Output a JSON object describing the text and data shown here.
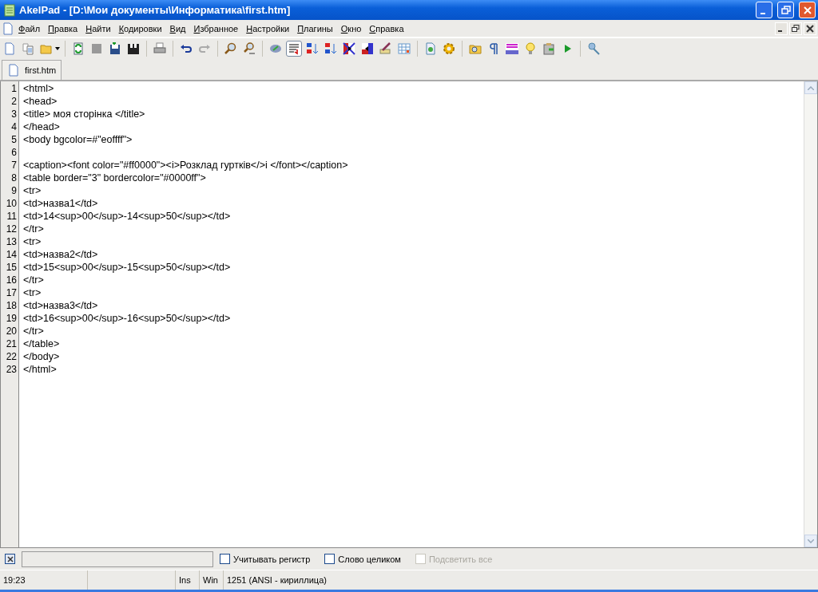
{
  "window": {
    "title": "AkelPad - [D:\\Мои документы\\Информатика\\first.htm]"
  },
  "menu": [
    "Файл",
    "Правка",
    "Найти",
    "Кодировки",
    "Вид",
    "Избранное",
    "Настройки",
    "Плагины",
    "Окно",
    "Справка"
  ],
  "tabs": [
    {
      "label": "first.htm",
      "selected": true
    }
  ],
  "editor": {
    "lines": [
      {
        "number": "1",
        "text": "<html>"
      },
      {
        "number": "2",
        "text": "<head>"
      },
      {
        "number": "3",
        "text": "<title> моя сторінка </title>"
      },
      {
        "number": "4",
        "text": "</head>"
      },
      {
        "number": "5",
        "text": "<body bgcolor=#\"eoffff\">"
      },
      {
        "number": "6"
      },
      {
        "number": "7",
        "text": "<caption><font color=\"#ff0000\"><i>Розклад гуртків</>i </font></caption>"
      },
      {
        "number": "8",
        "text": "<table border=\"3\" bordercolor=\"#0000ff\">"
      },
      {
        "number": "9",
        "text": "<tr>"
      },
      {
        "number": "10",
        "text": "<td>назва1</td>"
      },
      {
        "number": "11",
        "text": "<td>14<sup>00</sup>-14<sup>50</sup></td>"
      },
      {
        "number": "12",
        "text": "</tr>"
      },
      {
        "number": "13",
        "text": "<tr>"
      },
      {
        "number": "14",
        "text": "<td>назва2</td>"
      },
      {
        "number": "15",
        "text": "<td>15<sup>00</sup>-15<sup>50</sup></td>"
      },
      {
        "number": "16",
        "text": "</tr>"
      },
      {
        "number": "17",
        "text": "<tr>"
      },
      {
        "number": "18",
        "text": "<td>назва3</td>"
      },
      {
        "number": "19",
        "text": "<td>16<sup>00</sup>-16<sup>50</sup></td>"
      },
      {
        "number": "20",
        "text": "</tr>"
      },
      {
        "number": "21",
        "text": "</table>"
      },
      {
        "number": "22",
        "text": "</body>"
      },
      {
        "number": "23",
        "text": "</html>"
      }
    ]
  },
  "find_bar": {
    "options": [
      {
        "label": "Учитывать регистр",
        "checked": false,
        "disabled": false
      },
      {
        "label": "Слово целиком",
        "checked": false,
        "disabled": false
      },
      {
        "label": "Подсветить все",
        "checked": false,
        "disabled": true
      }
    ]
  },
  "status_bar": {
    "position": "19:23",
    "insert_mode": "Ins",
    "line_endings": "Win",
    "encoding": "1251  (ANSI - кириллица)"
  }
}
